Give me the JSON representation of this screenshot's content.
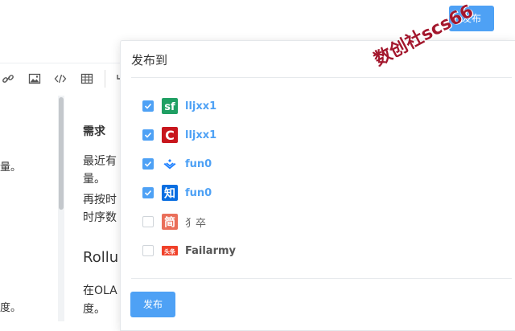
{
  "header": {
    "publish_label": "发布"
  },
  "toolbar": {
    "tools": [
      {
        "icon": "link-icon"
      },
      {
        "icon": "image-icon"
      },
      {
        "icon": "code-icon"
      },
      {
        "icon": "table-icon"
      },
      {
        "icon": "undo-icon"
      }
    ]
  },
  "editor_left": {
    "line1": "量。",
    "line2": "度。"
  },
  "editor_right": {
    "heading": "需求",
    "p1": "最近有",
    "p2": "量。",
    "p3": "再按时",
    "p4": "时序数",
    "heading2": "Rollu",
    "p5": "在OLA",
    "p6": "度。"
  },
  "popover": {
    "title": "发布到",
    "channels": [
      {
        "name": "lljxx1",
        "checked": true,
        "logo": "segmentfault-logo",
        "color": "#1f9f63",
        "logo_text": "sf"
      },
      {
        "name": "lljxx1",
        "checked": true,
        "logo": "csdn-logo",
        "color": "#c8161d",
        "logo_text": "C"
      },
      {
        "name": "fun0",
        "checked": true,
        "logo": "juejin-logo",
        "color": "#1e80ff"
      },
      {
        "name": "fun0",
        "checked": true,
        "logo": "zhihu-logo",
        "color": "#0a6ee1",
        "logo_text": "知"
      },
      {
        "name": "犭卒",
        "checked": false,
        "logo": "jianshu-logo",
        "color": "#ea6f5a",
        "logo_text": "简"
      },
      {
        "name": "Failarmy",
        "checked": false,
        "logo": "toutiao-logo",
        "color": "#f0412a",
        "logo_text": "头条"
      }
    ],
    "publish_label": "发布"
  },
  "watermark": {
    "text": "数创社scs66",
    "color": "#a3172d"
  }
}
